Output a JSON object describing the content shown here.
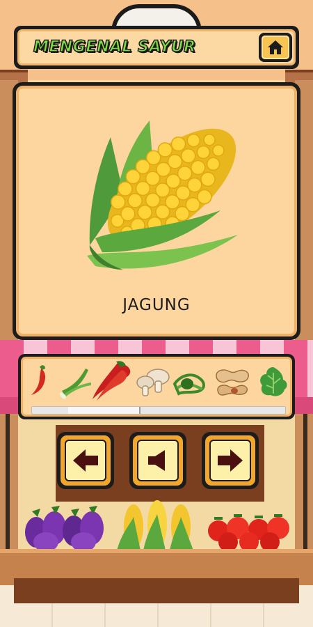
{
  "header": {
    "title": "MENGENAL SAYUR",
    "home_icon": "home-icon"
  },
  "card": {
    "vegetable_name": "JAGUNG",
    "image_icon": "corn-icon"
  },
  "selector": {
    "items": [
      {
        "icon": "chili-icon"
      },
      {
        "icon": "leek-icon"
      },
      {
        "icon": "red-chili-bunch-icon"
      },
      {
        "icon": "mushroom-icon"
      },
      {
        "icon": "long-bean-icon"
      },
      {
        "icon": "peanut-icon"
      },
      {
        "icon": "lettuce-icon"
      }
    ],
    "scroll_position": 0.2
  },
  "controls": {
    "previous_icon": "arrow-left-icon",
    "sound_icon": "speaker-icon",
    "next_icon": "arrow-right-icon"
  },
  "colors": {
    "title_green": "#7fde43",
    "card_bg": "#fcd59f",
    "button_gold": "#f2a72c",
    "awning_pink": "#ec5c8c"
  }
}
